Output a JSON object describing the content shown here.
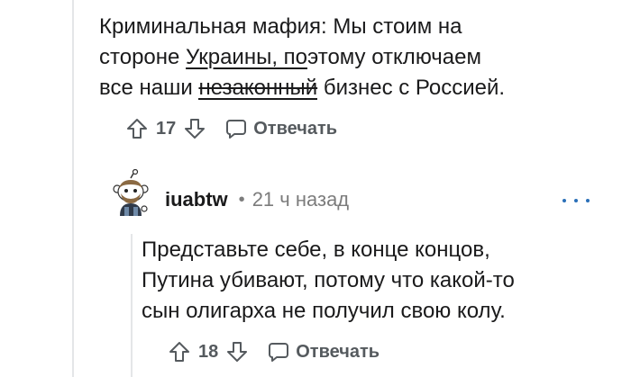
{
  "parent_comment": {
    "line1": "Криминальная мафия: Мы стоим на",
    "line2_before": "стороне ",
    "line2_link": "Украины, по",
    "line2_after": "этому отключаем",
    "line3_before": "все наши ",
    "line3_struck": "незаконный",
    "line3_after": " бизнес с Россией.",
    "votes": "17",
    "reply_label": "Отвечать"
  },
  "reply_comment": {
    "username": "iuabtw",
    "separator": "•",
    "timestamp": "21 ч назад",
    "line1": "Представьте себе, в конце концов,",
    "line2": "Путина убивают, потому что какой-то",
    "line3": "сын олигарха не получил свою колу.",
    "votes": "18",
    "reply_label": "Отвечать"
  },
  "colors": {
    "text": "#1a1a1b",
    "meta": "#7c7c7c",
    "action": "#555a5e",
    "thread_line": "#e4e6e8",
    "accent": "#2a6fb8"
  },
  "icons": [
    "upvote-icon",
    "downvote-icon",
    "comment-bubble-icon",
    "more-options-icon",
    "avatar"
  ]
}
